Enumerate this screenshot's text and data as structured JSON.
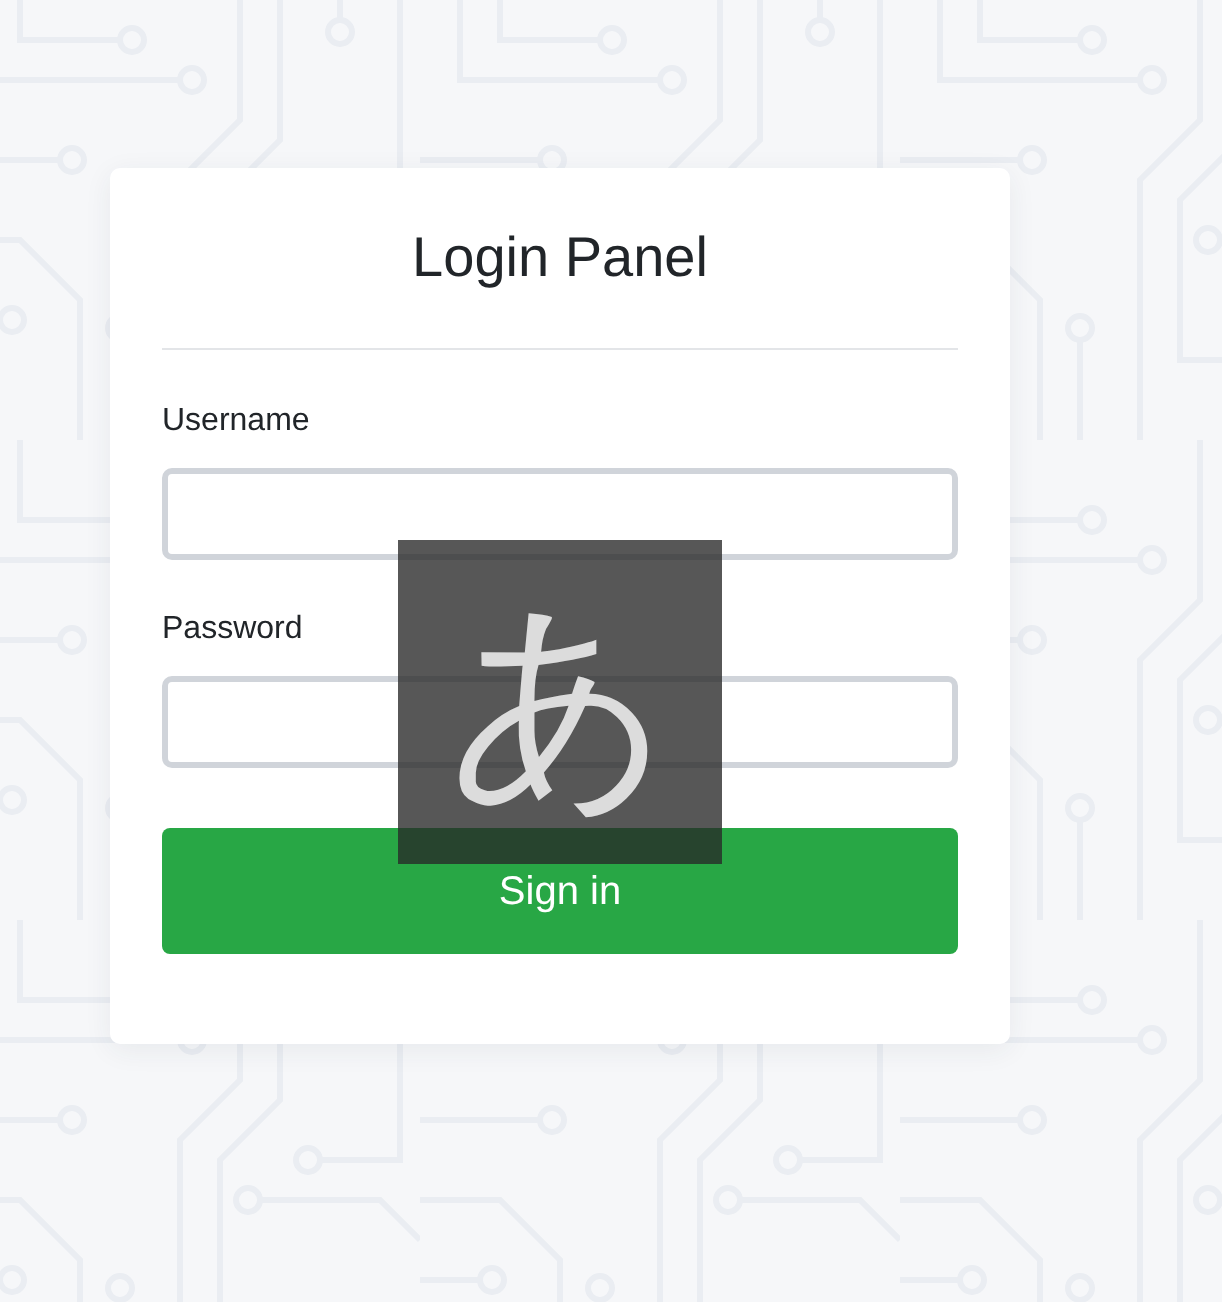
{
  "login_panel": {
    "title": "Login Panel",
    "fields": [
      {
        "label": "Username"
      },
      {
        "label": "Password"
      }
    ],
    "submit_button": "Sign in"
  },
  "ime_indicator": {
    "text": "あ"
  }
}
